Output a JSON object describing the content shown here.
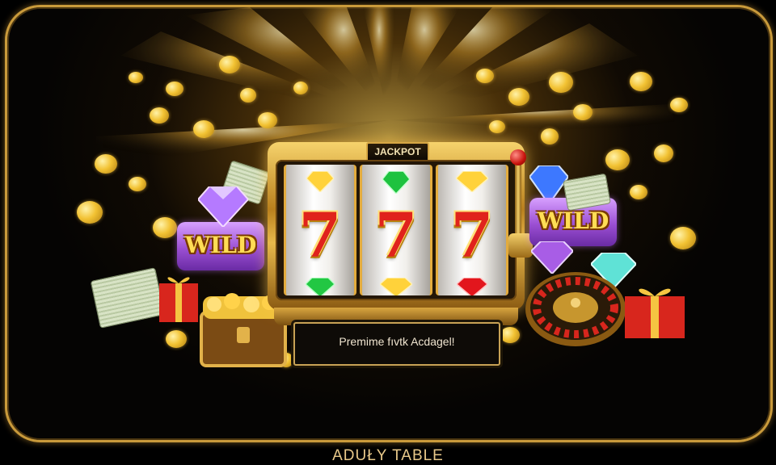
{
  "slot": {
    "header_label": "JACKPOT",
    "reels": [
      {
        "top_symbol": "yellow-diamond",
        "center_symbol": "7",
        "bottom_symbol": "green-gem"
      },
      {
        "top_symbol": "green-gem",
        "center_symbol": "7",
        "bottom_symbol": "yellow-diamond"
      },
      {
        "top_symbol": "yellow-diamond",
        "center_symbol": "7",
        "bottom_symbol": "red-gem"
      }
    ],
    "banner_text": "Premime fıvtk Acdagel!"
  },
  "left_wild": {
    "label": "WILD"
  },
  "right_wild": {
    "label": "WILD"
  },
  "caption": "ADUŁY TABLE",
  "colors": {
    "frame_gold": "#c99a3b",
    "seven_red": "#e0231c",
    "wild_purple": "#9b4fd3",
    "wild_text": "#ffdd55",
    "background": "#050403"
  }
}
